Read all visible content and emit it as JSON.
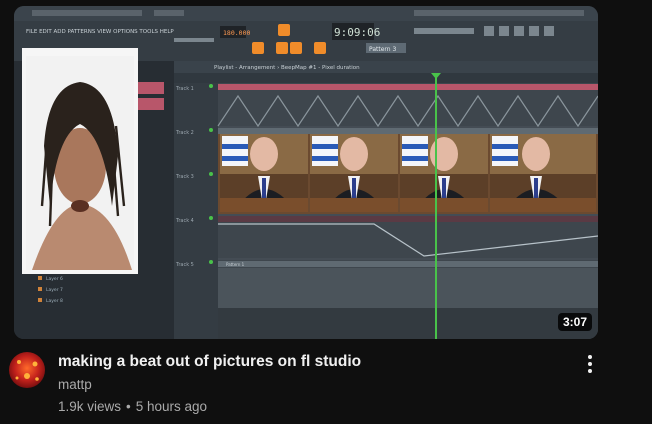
{
  "video": {
    "title": "making a beat out of pictures on fl studio",
    "channel": "mattp",
    "views": "1.9k views",
    "separator": "•",
    "uploaded": "5 hours ago",
    "duration": "3:07"
  },
  "thumbnail": {
    "menubar": "FILE  EDIT  ADD  PATTERNS  VIEW  OPTIONS  TOOLS  HELP",
    "tempo": "180.000",
    "time": "9:09:06",
    "pattern_selector": "Pattern 3",
    "playlist_title": "Playlist - Arrangement › BeepMap #1 - Pixel duration",
    "tracks": [
      "Track 1",
      "Track 2",
      "Track 3",
      "Track 4",
      "Track 5"
    ],
    "browser_items": [
      "Layer 6",
      "Layer 7",
      "Layer 8"
    ],
    "clip_label": "Pattern 1"
  },
  "colors": {
    "background": "#0f0f0f",
    "title": "#f1f1f1",
    "secondary": "#aaaaaa",
    "daw_bg": "#2c333a",
    "playhead": "#49c24a",
    "clip_red": "#b8566a"
  },
  "icons": {
    "more": "more-vert-icon",
    "avatar": "channel-avatar"
  }
}
